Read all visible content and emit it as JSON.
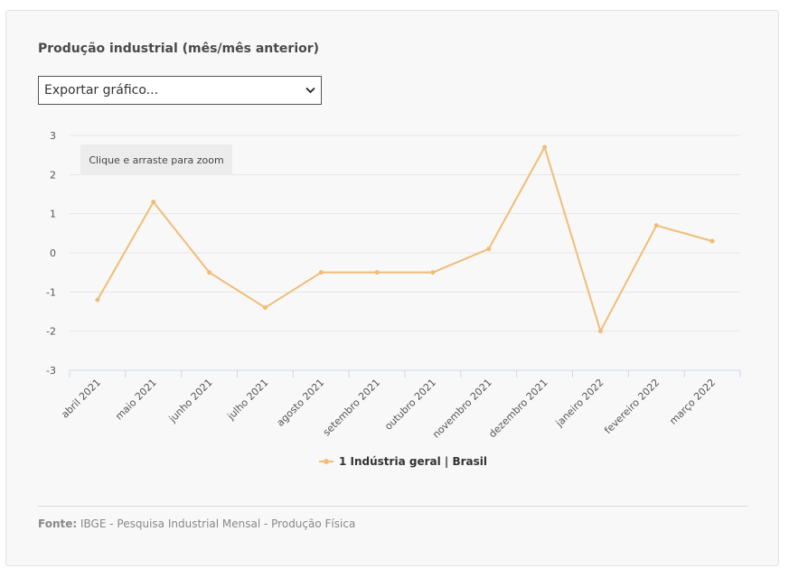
{
  "header": {
    "title": "Produção industrial (mês/mês anterior)",
    "export_label": "Exportar gráfico..."
  },
  "zoom_hint": "Clique e arraste para zoom",
  "source": {
    "label": "Fonte:",
    "text": "IBGE - Pesquisa Industrial Mensal - Produção Física"
  },
  "colors": {
    "series": "#f0bd76",
    "grid": "#e6e6e6",
    "axis": "#ccd6eb"
  },
  "chart_data": {
    "type": "line",
    "title": "",
    "xlabel": "",
    "ylabel": "",
    "ylim": [
      -3,
      3
    ],
    "yticks": [
      "3",
      "2",
      "1",
      "0",
      "-1",
      "-2",
      "-3"
    ],
    "grid": true,
    "legend_position": "bottom-center",
    "categories": [
      "abril 2021",
      "maio 2021",
      "junho 2021",
      "julho 2021",
      "agosto 2021",
      "setembro 2021",
      "outubro 2021",
      "novembro 2021",
      "dezembro 2021",
      "janeiro 2022",
      "fevereiro 2022",
      "março 2022"
    ],
    "series": [
      {
        "name": "1 Indústria geral | Brasil",
        "values": [
          -1.2,
          1.3,
          -0.5,
          -1.4,
          -0.5,
          -0.5,
          -0.5,
          0.1,
          2.7,
          -2.0,
          0.7,
          0.3
        ]
      }
    ]
  }
}
